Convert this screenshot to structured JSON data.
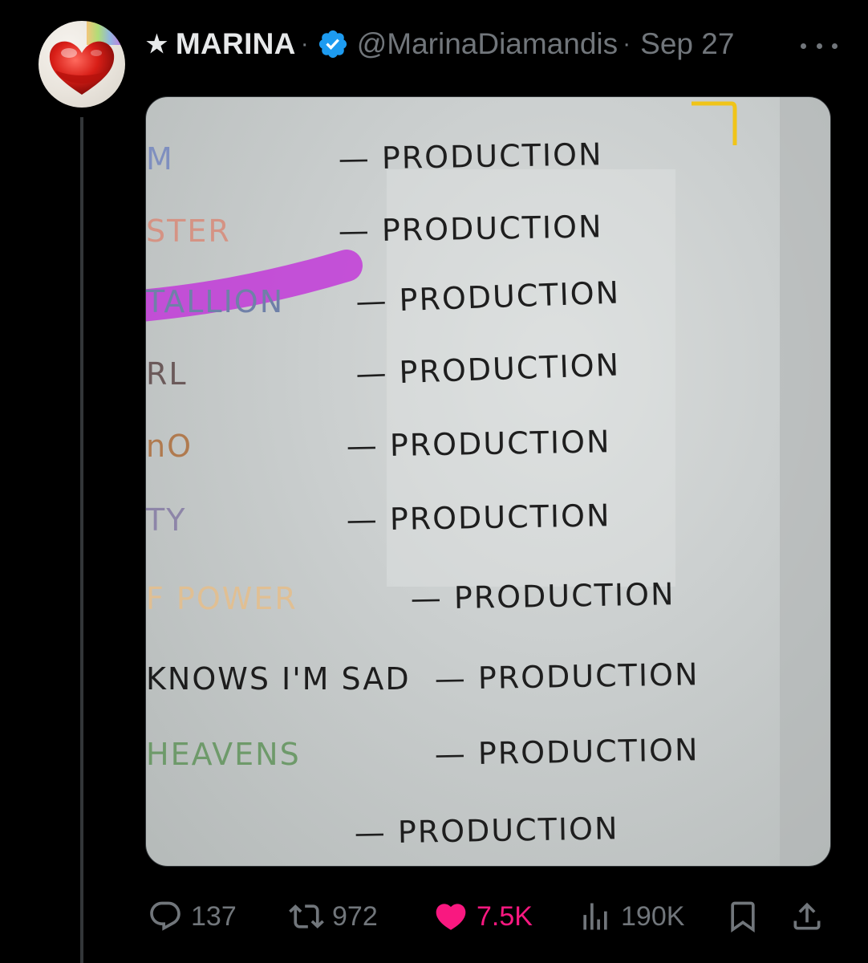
{
  "tweet": {
    "display_name": "MARINA",
    "name_prefix_symbol": "★",
    "handle": "@MarinaDiamandis",
    "separator": "·",
    "date": "Sep 27",
    "verified": true
  },
  "media": {
    "whiteboard_lines": [
      {
        "title": "M",
        "suffix": "— PRODUCTION",
        "title_color": "#7f8fbf"
      },
      {
        "title": "STER",
        "suffix": "— PRODUCTION",
        "title_color": "#d59384"
      },
      {
        "title": "TALLION",
        "suffix": "— PRODUCTION",
        "title_color": "#6f80a8",
        "highlight_color": "#c23ad8"
      },
      {
        "title": "RL",
        "suffix": "— PRODUCTION",
        "title_color": "#6b5a5a"
      },
      {
        "title": "nO",
        "suffix": "— PRODUCTION",
        "title_color": "#b07a4f"
      },
      {
        "title": "TY",
        "suffix": "— PRODUCTION",
        "title_color": "#8d85a8"
      },
      {
        "title": "F POWER",
        "suffix": "— PRODUCTION",
        "title_color": "#e0bf93"
      },
      {
        "title": "KNOWS I'M SAD",
        "suffix": "— PRODUCTION",
        "title_color": "#1d1d1d"
      },
      {
        "title": "HEAVENS",
        "suffix": "— PRODUCTION",
        "title_color": "#6e9a6a"
      },
      {
        "title": "",
        "suffix": "— PRODUCTION",
        "title_color": "#999999"
      }
    ]
  },
  "actions": {
    "replies": "137",
    "reposts": "972",
    "likes": "7.5K",
    "views": "190K"
  },
  "colors": {
    "background": "#000000",
    "secondary_text": "#71767b",
    "like_pink": "#f91880",
    "verified_blue": "#1d9bf0"
  },
  "icons": [
    "avatar-heart-icon",
    "verified-badge-icon",
    "more-icon",
    "reply-icon",
    "repost-icon",
    "like-heart-icon",
    "views-icon",
    "bookmark-icon",
    "share-icon"
  ]
}
